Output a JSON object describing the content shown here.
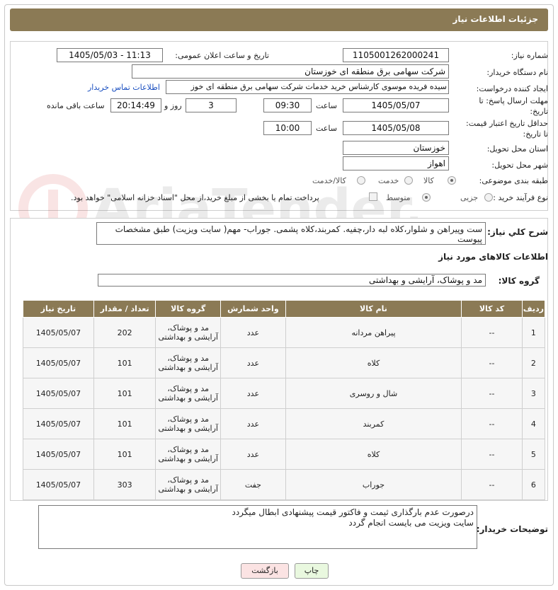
{
  "header": {
    "title": "جزئیات اطلاعات نیاز"
  },
  "form": {
    "need_number_label": "شماره نیاز:",
    "need_number": "1105001262000241",
    "announce_label": "تاریخ و ساعت اعلان عمومی:",
    "announce_value": "1405/05/03 - 11:13",
    "buyer_org_label": "نام دستگاه خریدار:",
    "buyer_org": "شرکت سهامی برق منطقه ای خوزستان",
    "creator_label": "ایجاد کننده درخواست:",
    "creator": "سیده فریده موسوی کارشناس خرید خدمات شرکت سهامی برق منطقه ای خوز",
    "contact_link": "اطلاعات تماس خریدار",
    "deadline_label_1": "مهلت ارسال پاسخ: تا",
    "deadline_label_2": "تاریخ:",
    "deadline_date": "1405/05/07",
    "time_label": "ساعت",
    "deadline_time": "09:30",
    "days_value": "3",
    "days_label": "روز و",
    "remaining_time": "20:14:49",
    "remaining_label": "ساعت باقی مانده",
    "validity_label_1": "حداقل تاریخ اعتبار قیمت:",
    "validity_label_2": "تا تاریخ:",
    "validity_date": "1405/05/08",
    "validity_time": "10:00",
    "province_label": "استان محل تحویل:",
    "province": "خوزستان",
    "city_label": "شهر محل تحویل:",
    "city": "اهواز",
    "category_label": "طبقه بندی موضوعی:",
    "category_options": [
      "کالا",
      "خدمت",
      "کالا/خدمت"
    ],
    "process_label": "نوع فرآیند خرید :",
    "process_options": [
      "جزیی",
      "متوسط"
    ],
    "payment_note": "پرداخت تمام یا بخشی از مبلغ خرید،از محل \"اسناد خزانه اسلامی\" خواهد بود."
  },
  "summary": {
    "label": "شرح کلي نياز:",
    "text": "ست وپیراهن و شلوار،کلاه لبه دار،چفیه. کمربند،کلاه پشمی. جوراب- مهم( سایت ویزیت) طبق  مشخصات پیوست"
  },
  "goods": {
    "section_title": "اطلاعات کالاهای مورد نیاز",
    "group_label": "گروه کالا:",
    "group_value": "مد و پوشاک، آرایشی و بهداشتی"
  },
  "table": {
    "headers": [
      "ردیف",
      "کد کالا",
      "نام کالا",
      "واحد شمارش",
      "گروه کالا",
      "تعداد / مقدار",
      "تاریخ نیاز"
    ],
    "rows": [
      [
        "1",
        "--",
        "پیراهن مردانه",
        "عدد",
        "مد و پوشاک، آرایشی و بهداشتی",
        "202",
        "1405/05/07"
      ],
      [
        "2",
        "--",
        "کلاه",
        "عدد",
        "مد و پوشاک، آرایشی و بهداشتی",
        "101",
        "1405/05/07"
      ],
      [
        "3",
        "--",
        "شال و روسری",
        "عدد",
        "مد و پوشاک، آرایشی و بهداشتی",
        "101",
        "1405/05/07"
      ],
      [
        "4",
        "--",
        "کمربند",
        "عدد",
        "مد و پوشاک، آرایشی و بهداشتی",
        "101",
        "1405/05/07"
      ],
      [
        "5",
        "--",
        "کلاه",
        "عدد",
        "مد و پوشاک، آرایشی و بهداشتی",
        "101",
        "1405/05/07"
      ],
      [
        "6",
        "--",
        "جوراب",
        "جفت",
        "مد و پوشاک، آرایشی و بهداشتی",
        "303",
        "1405/05/07"
      ]
    ]
  },
  "buyer_notes": {
    "label": "توضیحات خریدار:",
    "line1": "درصورت عدم بارگذاری ثیمت و فاکتور قیمت پیشنهادی ابطال میگردد",
    "line2": "سایت ویزیت می بایست انجام گردد"
  },
  "buttons": {
    "print": "چاپ",
    "back": "بازگشت"
  },
  "watermark": {
    "text": "AriaTender.net"
  },
  "colors": {
    "header": "#8b7a55",
    "print_button": "#e9f8df",
    "back_button": "#fbe3e3"
  }
}
